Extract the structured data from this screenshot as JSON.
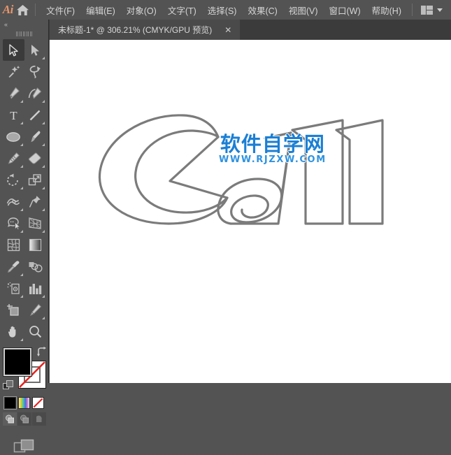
{
  "app": {
    "name": "Ai",
    "logo_color": "#e8956b",
    "bg_color": "#535353"
  },
  "menubar": {
    "home_icon": "home-icon",
    "items": [
      {
        "label": "文件(F)",
        "name": "menu-file"
      },
      {
        "label": "编辑(E)",
        "name": "menu-edit"
      },
      {
        "label": "对象(O)",
        "name": "menu-object"
      },
      {
        "label": "文字(T)",
        "name": "menu-type"
      },
      {
        "label": "选择(S)",
        "name": "menu-select"
      },
      {
        "label": "效果(C)",
        "name": "menu-effect"
      },
      {
        "label": "视图(V)",
        "name": "menu-view"
      },
      {
        "label": "窗口(W)",
        "name": "menu-window"
      },
      {
        "label": "帮助(H)",
        "name": "menu-help"
      }
    ],
    "workspace_switcher": "workspace-icon",
    "workspace_chevron": "chevron-down-icon"
  },
  "tabbar": {
    "tab_title": "未标题-1* @ 306.21% (CMYK/GPU 预览)",
    "close_label": "✕"
  },
  "toolpanel": {
    "collapse_label": "«",
    "tools": [
      {
        "name": "selection-tool",
        "active": true,
        "corner": false
      },
      {
        "name": "direct-selection-tool",
        "active": false,
        "corner": true
      },
      {
        "name": "magic-wand-tool",
        "active": false,
        "corner": false
      },
      {
        "name": "lasso-tool",
        "active": false,
        "corner": false
      },
      {
        "name": "pen-tool",
        "active": false,
        "corner": true
      },
      {
        "name": "curvature-tool",
        "active": false,
        "corner": true
      },
      {
        "name": "type-tool",
        "active": false,
        "corner": true
      },
      {
        "name": "line-segment-tool",
        "active": false,
        "corner": true
      },
      {
        "name": "ellipse-tool",
        "active": false,
        "corner": true
      },
      {
        "name": "paintbrush-tool",
        "active": false,
        "corner": true
      },
      {
        "name": "shaper-pencil-tool",
        "active": false,
        "corner": true
      },
      {
        "name": "eraser-tool",
        "active": false,
        "corner": true
      },
      {
        "name": "rotate-tool",
        "active": false,
        "corner": true
      },
      {
        "name": "scale-tool",
        "active": false,
        "corner": true
      },
      {
        "name": "width-tool",
        "active": false,
        "corner": true
      },
      {
        "name": "free-transform-tool",
        "active": false,
        "corner": true
      },
      {
        "name": "shape-builder-tool",
        "active": false,
        "corner": true
      },
      {
        "name": "perspective-grid-tool",
        "active": false,
        "corner": true
      },
      {
        "name": "mesh-tool",
        "active": false,
        "corner": false
      },
      {
        "name": "gradient-tool",
        "active": false,
        "corner": false
      },
      {
        "name": "eyedropper-tool",
        "active": false,
        "corner": true
      },
      {
        "name": "blend-tool",
        "active": false,
        "corner": false
      },
      {
        "name": "symbol-sprayer-tool",
        "active": false,
        "corner": true
      },
      {
        "name": "column-graph-tool",
        "active": false,
        "corner": true
      },
      {
        "name": "artboard-tool",
        "active": false,
        "corner": false
      },
      {
        "name": "slice-tool",
        "active": false,
        "corner": true
      },
      {
        "name": "hand-tool",
        "active": false,
        "corner": true
      },
      {
        "name": "zoom-tool",
        "active": false,
        "corner": false
      }
    ],
    "fill_color": "#000000",
    "stroke_color": "#ffffff",
    "swatches": [
      {
        "name": "color-swatch",
        "kind": "black"
      },
      {
        "name": "gradient-swatch",
        "kind": "gradient"
      },
      {
        "name": "none-swatch",
        "kind": "none"
      }
    ],
    "draw_modes": [
      {
        "name": "draw-normal-mode",
        "on": true
      },
      {
        "name": "draw-behind-mode",
        "on": false
      },
      {
        "name": "draw-inside-mode",
        "on": false
      }
    ],
    "screen_mode": "screen-mode-button"
  },
  "canvas": {
    "background": "#ffffff",
    "artwork_text": "Call",
    "artwork_stroke_color": "#7b7b7b",
    "watermark": {
      "brand": "软件自学网",
      "url": "WWW.RJZXW.COM",
      "brand_color": "#1b7fd4",
      "url_color": "#2f93e0"
    }
  }
}
